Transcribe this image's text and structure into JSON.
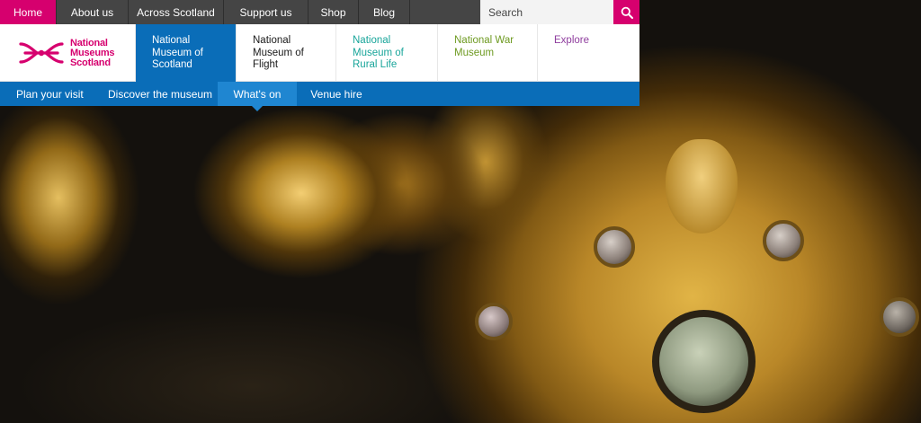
{
  "top_nav": {
    "items": [
      {
        "label": "Home"
      },
      {
        "label": "About us"
      },
      {
        "label": "Across Scotland"
      },
      {
        "label": "Support us"
      },
      {
        "label": "Shop"
      },
      {
        "label": "Blog"
      }
    ],
    "active": "Home"
  },
  "search": {
    "placeholder": "Search",
    "button_icon": "search-icon"
  },
  "logo": {
    "line1": "National",
    "line2": "Museums",
    "line3": "Scotland"
  },
  "museums": [
    {
      "line1": "National",
      "line2": "Museum of",
      "line3": "Scotland"
    },
    {
      "line1": "National",
      "line2": "Museum of",
      "line3": "Flight"
    },
    {
      "line1": "National",
      "line2": "Museum of",
      "line3": "Rural Life"
    },
    {
      "line1": "National War",
      "line2": "Museum",
      "line3": ""
    },
    {
      "line1": "Explore",
      "line2": "",
      "line3": ""
    }
  ],
  "sub_nav": {
    "items": [
      {
        "label": "Plan your visit"
      },
      {
        "label": "Discover the museum"
      },
      {
        "label": "What's on"
      },
      {
        "label": "Venue hire"
      }
    ],
    "active": "What's on"
  },
  "colors": {
    "brand_pink": "#d6006e",
    "nav_blue": "#0a6db8",
    "top_bar_gray": "#454545",
    "rural_life_teal": "#18a59a",
    "war_museum_green": "#6e9a21",
    "explore_purple": "#8f3d9e"
  }
}
